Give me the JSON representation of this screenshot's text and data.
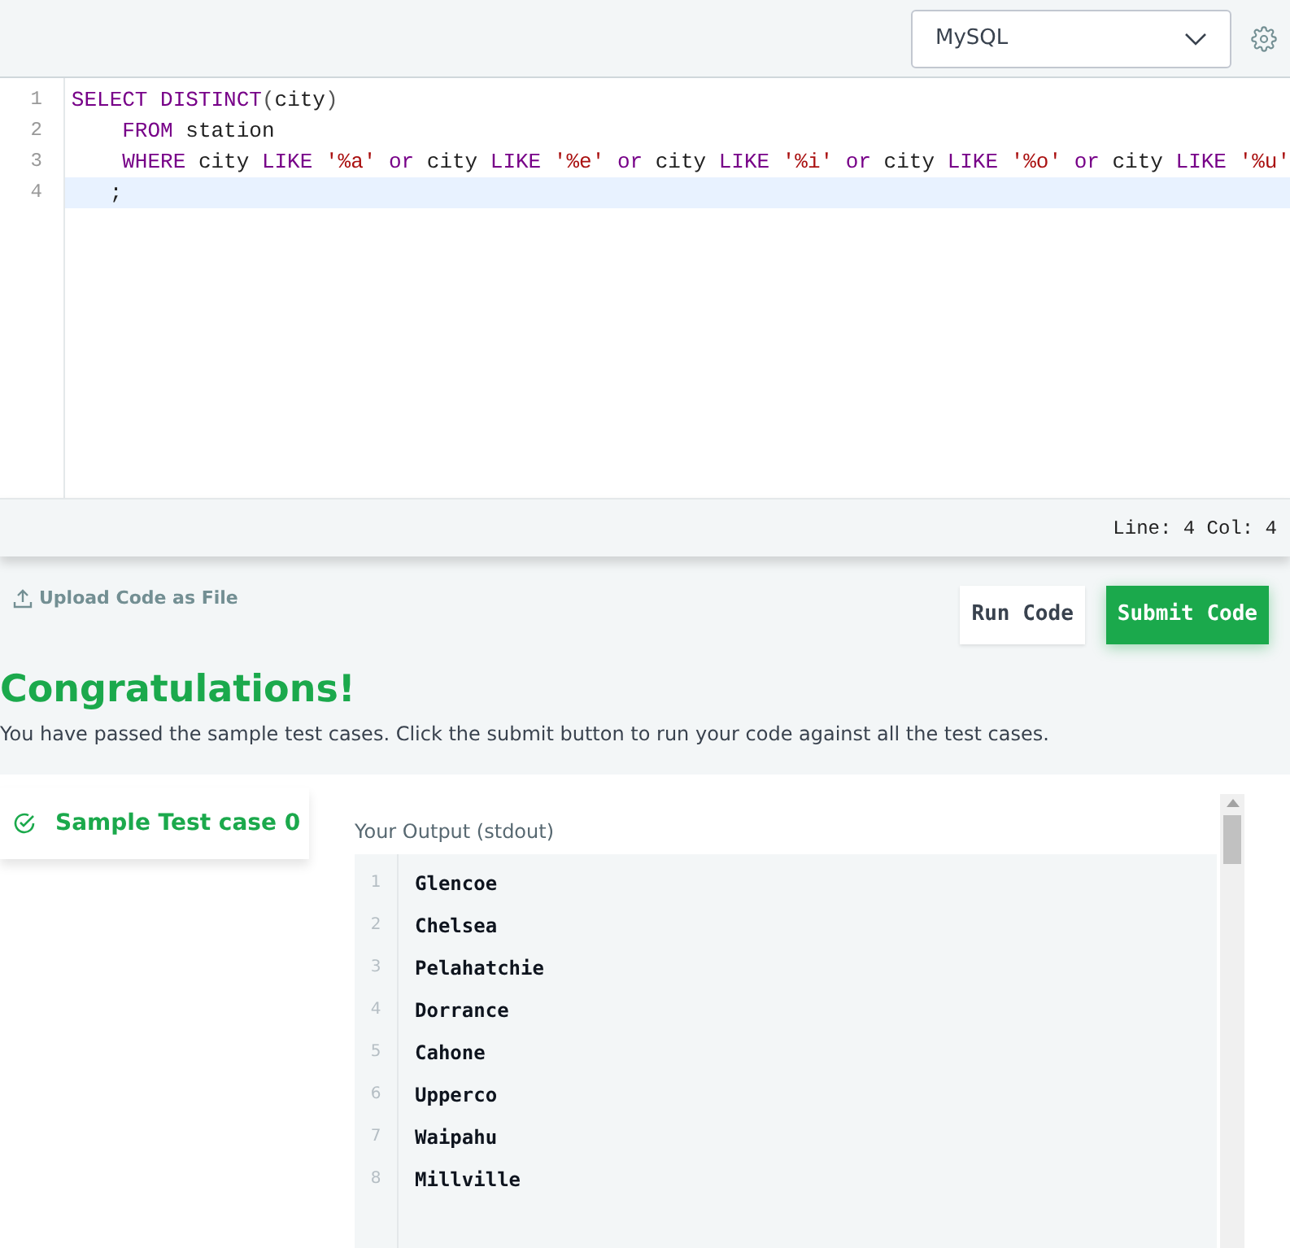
{
  "toolbar": {
    "language": "MySQL"
  },
  "editor": {
    "lines": [
      {
        "number": "1",
        "active": false,
        "tokens": [
          {
            "kind": "keyword",
            "text": "SELECT DISTINCT"
          },
          {
            "kind": "punct",
            "text": "("
          },
          {
            "kind": "plain",
            "text": "city"
          },
          {
            "kind": "punct",
            "text": ")"
          }
        ]
      },
      {
        "number": "2",
        "active": false,
        "tokens": [
          {
            "kind": "keyword",
            "text": "    FROM"
          },
          {
            "kind": "plain",
            "text": " station"
          }
        ]
      },
      {
        "number": "3",
        "active": false,
        "tokens": [
          {
            "kind": "keyword",
            "text": "    WHERE"
          },
          {
            "kind": "plain",
            "text": " city "
          },
          {
            "kind": "keyword",
            "text": "LIKE"
          },
          {
            "kind": "string",
            "text": " '%a' "
          },
          {
            "kind": "keyword",
            "text": "or"
          },
          {
            "kind": "plain",
            "text": " city "
          },
          {
            "kind": "keyword",
            "text": "LIKE"
          },
          {
            "kind": "string",
            "text": " '%e' "
          },
          {
            "kind": "keyword",
            "text": "or"
          },
          {
            "kind": "plain",
            "text": " city "
          },
          {
            "kind": "keyword",
            "text": "LIKE"
          },
          {
            "kind": "string",
            "text": " '%i' "
          },
          {
            "kind": "keyword",
            "text": "or"
          },
          {
            "kind": "plain",
            "text": " city "
          },
          {
            "kind": "keyword",
            "text": "LIKE"
          },
          {
            "kind": "string",
            "text": " '%o' "
          },
          {
            "kind": "keyword",
            "text": "or"
          },
          {
            "kind": "plain",
            "text": " city "
          },
          {
            "kind": "keyword",
            "text": "LIKE"
          },
          {
            "kind": "string",
            "text": " '%u'"
          }
        ]
      },
      {
        "number": "4",
        "active": true,
        "tokens": [
          {
            "kind": "plain",
            "text": "   ;"
          }
        ]
      }
    ],
    "status": "Line: 4 Col: 4"
  },
  "actions": {
    "upload": "Upload Code as File",
    "run": "Run Code",
    "submit": "Submit Code"
  },
  "result": {
    "title": "Congratulations!",
    "message": "You have passed the sample test cases. Click the submit button to run your code against all the test cases."
  },
  "test_cases": [
    {
      "label": "Sample Test case 0",
      "selected": true,
      "passed": true
    }
  ],
  "output": {
    "heading": "Your Output (stdout)",
    "lines": [
      {
        "number": "1",
        "text": "Glencoe"
      },
      {
        "number": "2",
        "text": "Chelsea"
      },
      {
        "number": "3",
        "text": "Pelahatchie"
      },
      {
        "number": "4",
        "text": "Dorrance"
      },
      {
        "number": "5",
        "text": "Cahone"
      },
      {
        "number": "6",
        "text": "Upperco"
      },
      {
        "number": "7",
        "text": "Waipahu"
      },
      {
        "number": "8",
        "text": "Millville"
      }
    ]
  }
}
